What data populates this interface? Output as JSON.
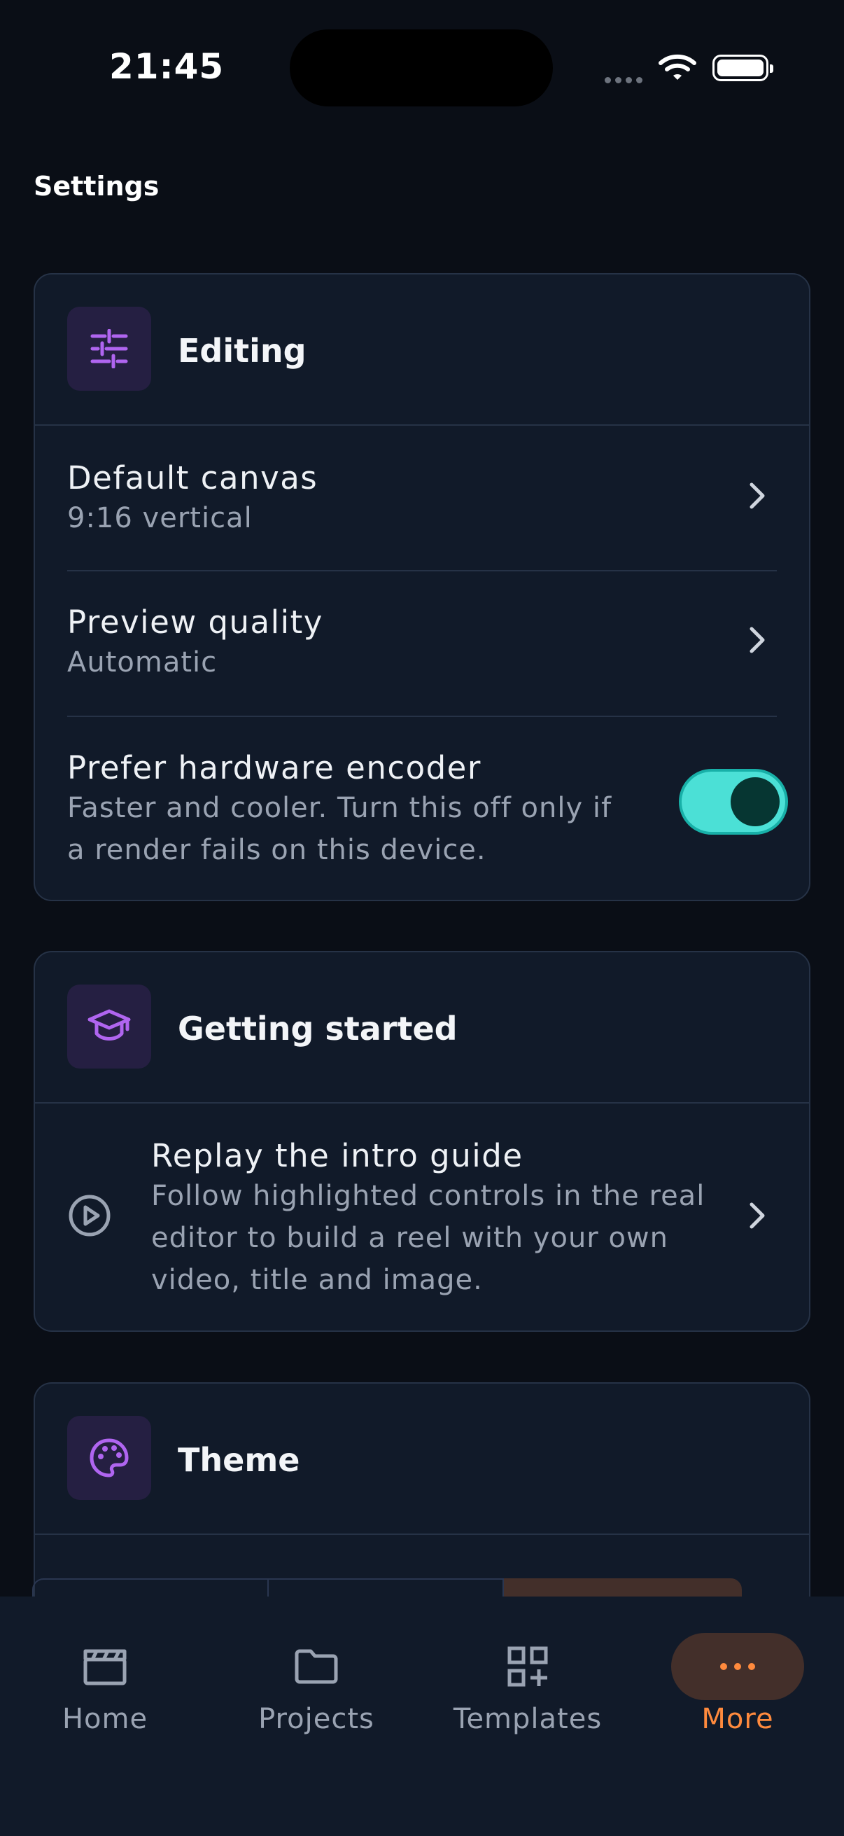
{
  "status_bar": {
    "time": "21:45"
  },
  "page": {
    "title": "Settings"
  },
  "editing": {
    "title": "Editing",
    "default_canvas": {
      "label": "Default canvas",
      "value": "9:16 vertical"
    },
    "preview_quality": {
      "label": "Preview quality",
      "value": "Automatic"
    },
    "hardware_encoder": {
      "label": "Prefer hardware encoder",
      "description_line1": "Faster and cooler. Turn this off only if",
      "description_line2": "a render fails on this device.",
      "enabled": true
    }
  },
  "getting_started": {
    "title": "Getting started",
    "replay": {
      "label": "Replay the intro guide",
      "line1": "Follow highlighted controls in the real",
      "line2": "editor to build a reel with your own",
      "line3": "video, title and image."
    }
  },
  "theme": {
    "title": "Theme"
  },
  "tabs": [
    {
      "label": "Home",
      "icon": "clapperboard-icon"
    },
    {
      "label": "Projects",
      "icon": "folder-icon"
    },
    {
      "label": "Templates",
      "icon": "grid-plus-icon"
    },
    {
      "label": "More",
      "icon": "more-dots-icon",
      "active": true
    }
  ],
  "colors": {
    "accent_toggle": "#4be0d6",
    "accent_tab": "#ff8a3d",
    "icon_purple": "#b065f0"
  }
}
